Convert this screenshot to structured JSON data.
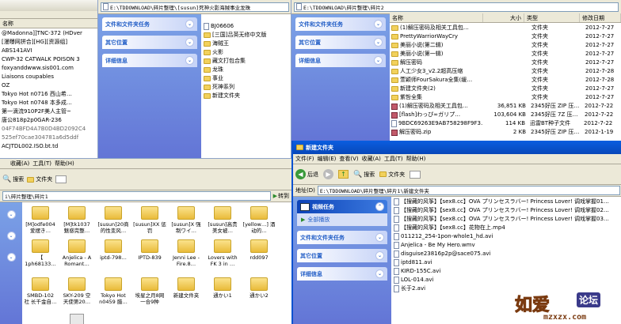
{
  "win_tl": {
    "column_name": "名称",
    "items": [
      "@Madonna]]TNC-372 (HDver",
      "[漫曝网拼合][HG][资源组]",
      "ABS141AVI",
      "CWP-32 CATWALK POISON 3",
      "foxyanddwww.sis001.com",
      "Liaisons coupables",
      "OZ",
      "Tokyo Hot n0716 西山希…",
      "Tokyo Hot n0748 本多成…",
      "第一滴流910P2F美人主管~",
      "唐公818p2p0GAR-236",
      "04F74BFD4A7B0D4BD2092C4",
      "525ef70cae304781a6d5ddf",
      "ACJTDL002.ISO.bt.td"
    ]
  },
  "win_tm": {
    "address": "E:\\TDDOWNLOAD\\碎片整理\\[susun]死神火影海贼事业龙珠",
    "panels": [
      "文件和文件夹任务",
      "其它位置",
      "详细信息"
    ],
    "items": [
      "BJ06606",
      "[三国]吕英无修中文版",
      "海贼王",
      "火影",
      "藏文打包合集",
      "龙珠",
      "事业",
      "死神系列",
      "新建文件夹"
    ]
  },
  "win_tr": {
    "address": "E:\\TDDOWNLOAD\\碎片整理\\碎片2",
    "panels": [
      "文件和文件夹任务",
      "其它位置",
      "详细信息"
    ],
    "headers": [
      "名称",
      "大小",
      "类型",
      "修改日期"
    ],
    "rows": [
      {
        "name": "(1)解压密码及相关工具包…",
        "size": "",
        "type": "文件夹",
        "date": "2012-7-27",
        "kind": "folder"
      },
      {
        "name": "PrettyWarriorWayCry",
        "size": "",
        "type": "文件夹",
        "date": "2012-7-27",
        "kind": "folder"
      },
      {
        "name": "美丽小说(第二辑)",
        "size": "",
        "type": "文件夹",
        "date": "2012-7-27",
        "kind": "folder"
      },
      {
        "name": "美丽小说(第一辑)",
        "size": "",
        "type": "文件夹",
        "date": "2012-7-27",
        "kind": "folder"
      },
      {
        "name": "解压密码",
        "size": "",
        "type": "文件夹",
        "date": "2012-7-27",
        "kind": "folder"
      },
      {
        "name": "人工少女3_v2.2超高压缩",
        "size": "",
        "type": "文件夹",
        "date": "2012-7-28",
        "kind": "folder"
      },
      {
        "name": "萱颖师FourSakura全集(缓…",
        "size": "",
        "type": "文件夹",
        "date": "2012-7-28",
        "kind": "folder"
      },
      {
        "name": "新建文件夹(2)",
        "size": "",
        "type": "文件夹",
        "date": "2012-7-27",
        "kind": "folder"
      },
      {
        "name": "紫哲全集",
        "size": "",
        "type": "文件夹",
        "date": "2012-7-27",
        "kind": "folder"
      },
      {
        "name": "(1)解压密码及相关工具包…",
        "size": "36,851 KB",
        "type": "2345好压 ZIP 压…",
        "date": "2012-7-22",
        "kind": "zip"
      },
      {
        "name": "[flash]わっぴ∞ガリプ…",
        "size": "103,604 KB",
        "type": "2345好压 7Z 压…",
        "date": "2012-7-22",
        "kind": "zip"
      },
      {
        "name": "9BDC69263E9AB758298F9F3…",
        "size": "114 KB",
        "type": "迅雷BT种子文件",
        "date": "2012-7-22",
        "kind": "file"
      },
      {
        "name": "解压密码.zip",
        "size": "2 KB",
        "type": "2345好压 ZIP 压…",
        "date": "2012-1-19",
        "kind": "zip"
      }
    ]
  },
  "win_bl": {
    "menu": [
      "收藏(A)",
      "工具(T)",
      "帮助(H)"
    ],
    "search_label": "搜索",
    "folders_label": "文件夹",
    "address": "i\\碎片整理\\碎片1",
    "go_label": "转到",
    "grid": [
      [
        "[M]odfe004 爱摆き…",
        "[M]tk1037 魅惑完整…",
        "[susun]20商 的性变风…",
        "[susun]XX 惩罚",
        "[susun]X 强制ワイ…",
        "[susun]高贵 美女被…",
        "[yellow…] 酒动的…"
      ],
      [
        "【 1ph68133…",
        "Anjelica - A Romant…",
        "iptd-798…",
        "IPTD-839",
        "Jenni Lee - Fire.8…",
        "Lovers with FK 3 in …",
        "rdd097"
      ],
      [
        "SMBD-102 社 长千金自…",
        "SKY-209 空 天使第20…",
        "Tokyo Hot n0459 腊…",
        "埃星之月8网 一合9种",
        "新建文件夹",
        "通かい1",
        "通かい2"
      ]
    ]
  },
  "win_br": {
    "title": "新建文件夹",
    "menu": [
      "文件(F)",
      "编辑(E)",
      "查看(V)",
      "收藏(A)",
      "工具(T)",
      "帮助(H)"
    ],
    "back_label": "后退",
    "search_label": "搜索",
    "folders_label": "文件夹",
    "address_label": "地址(D)",
    "address": "E:\\TDDOWNLOAD\\碎片整理\\碎片1\\新建文件夹",
    "panels": [
      "视频任务",
      "文件和文件夹任务",
      "其它位置",
      "详细信息"
    ],
    "video_action": "全部播放",
    "files": [
      "【搜藏的风筝】【sex8.cc】OVA プリンセスラバー! Princess Lover! 调戏掌握01…",
      "【搜藏的风筝】【sex8.cc】OVA プリンセスラバー! Princess Lover! 调戏掌握02…",
      "【搜藏的风筝】【sex8.cc】OVA プリンセスラバー! Princess Lover! 调戏掌握03…",
      "【搜藏的风筝】【sex8.cc】花物在上.mp4",
      "011212_254-1pon-whole1_hd.avi",
      "Anjelica - Be My Hero.wmv",
      "disguise23816p2p@sace075.avi",
      "iptd811.avi",
      "KIRD-155C.avi",
      "LOL-014.avi",
      "长于2.avi"
    ]
  },
  "watermark": {
    "brand": "如爱",
    "forum": "论坛",
    "url": "mzxzx.com"
  }
}
